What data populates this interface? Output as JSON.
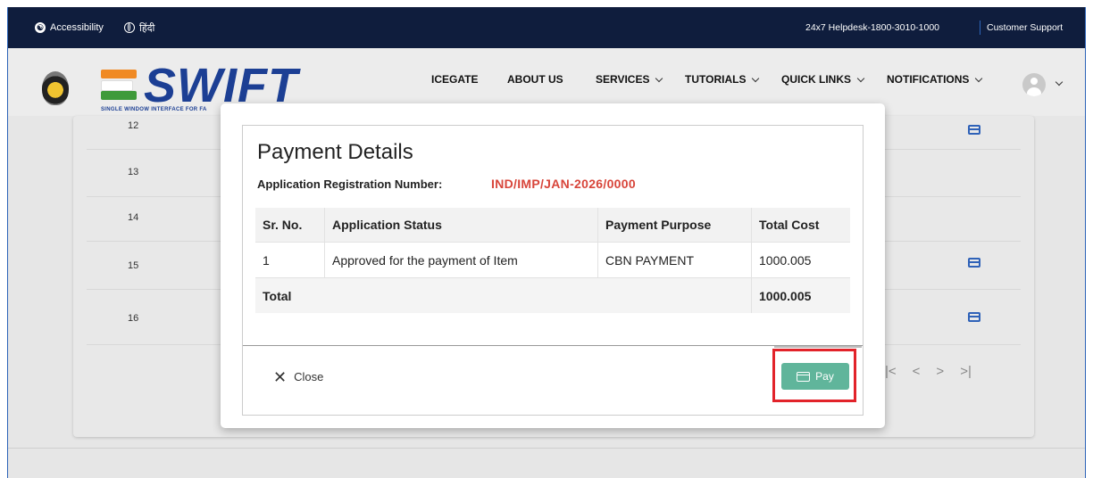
{
  "topbar": {
    "accessibility": "Accessibility",
    "hindi": "हिंदी",
    "helpdesk": "24x7 Helpdesk-1800-3010-1000",
    "support": "Customer Support"
  },
  "brand": {
    "logo": "SWIFT",
    "tagline": "SINGLE WINDOW INTERFACE FOR FA"
  },
  "nav": {
    "items": [
      {
        "label": "ICEGATE"
      },
      {
        "label": "ABOUT US"
      },
      {
        "label": "SERVICES"
      },
      {
        "label": "TUTORIALS"
      },
      {
        "label": "QUICK LINKS"
      },
      {
        "label": "NOTIFICATIONS"
      }
    ]
  },
  "background_rows": [
    "12",
    "13",
    "14",
    "15",
    "16"
  ],
  "modal": {
    "title": "Payment Details",
    "reg_label": "Application Registration Number:",
    "reg_value": "IND/IMP/JAN-2026/0000",
    "columns": [
      "Sr. No.",
      "Application Status",
      "Payment Purpose",
      "Total Cost"
    ],
    "rows": [
      {
        "sr": "1",
        "status": "Approved for the payment of Item",
        "purpose": "CBN PAYMENT",
        "cost": "1000.005"
      }
    ],
    "total_label": "Total",
    "total_value": "1000.005",
    "close_label": "Close",
    "pay_label": "Pay"
  },
  "colors": {
    "topbar": "#0f1d3d",
    "brand_blue": "#1c3f94",
    "reg_number": "#d8453a",
    "pay_button": "#60b59b",
    "highlight": "#e2232a"
  }
}
